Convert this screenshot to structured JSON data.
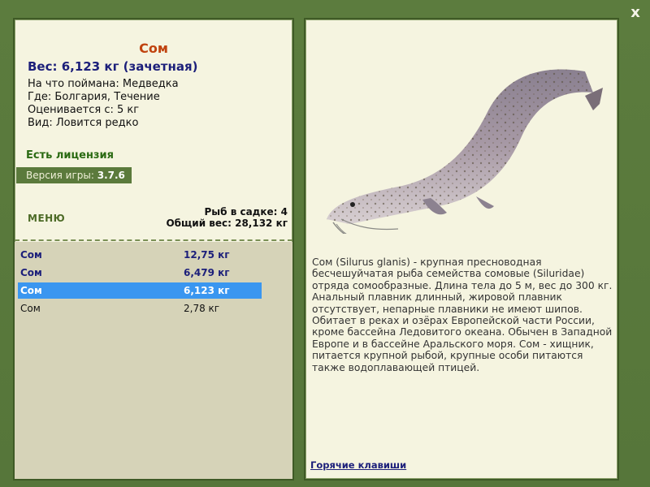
{
  "window": {
    "close_label": "x"
  },
  "fish": {
    "name": "Сом",
    "weight_line": "Вес: 6,123 кг (зачетная)",
    "caught_on": "На что поймана: Медведка",
    "where": "Где: Болгария, Течение",
    "valued_from": "Оценивается с: 5 кг",
    "kind": "Вид: Ловится редко",
    "license": "Есть лицензия",
    "version_label": "Версия игры:",
    "version_value": "3.7.6",
    "description": "Сом (Silurus glanis) - крупная пресноводная бесчешуйчатая рыба семейства сомовые (Siluridae) отряда сомообразные. Длина тела до 5 м, вес до 300 кг. Анальный плавник длинный, жировой плавник отсутствует, непарные плавники не имеют шипов. Обитает в реках и озёрах Европейской части России, кроме бассейна Ледовитого океана. Обычен в Западной Европе и в бассейне Аральского моря. Сом - хищник, питается крупной рыбой, крупные особи питаются также водоплавающей птицей."
  },
  "menu": {
    "label": "МЕНЮ"
  },
  "cage": {
    "count_line": "Рыб в садке: 4",
    "total_line": "Общий вес: 28,132 кг"
  },
  "catch_list": [
    {
      "name": "Сом",
      "weight": "12,75 кг"
    },
    {
      "name": "Сом",
      "weight": "6,479 кг"
    },
    {
      "name": "Сом",
      "weight": "6,123 кг"
    },
    {
      "name": "Сом",
      "weight": "2,78 кг"
    }
  ],
  "hotkeys_label": "Горячие клавиши",
  "colors": {
    "frame_green": "#5a7a3c",
    "panel_bg": "#f5f4e0",
    "title_orange": "#c0430f",
    "text_navy": "#1c1f7a",
    "selection_blue": "#3a96f0"
  }
}
